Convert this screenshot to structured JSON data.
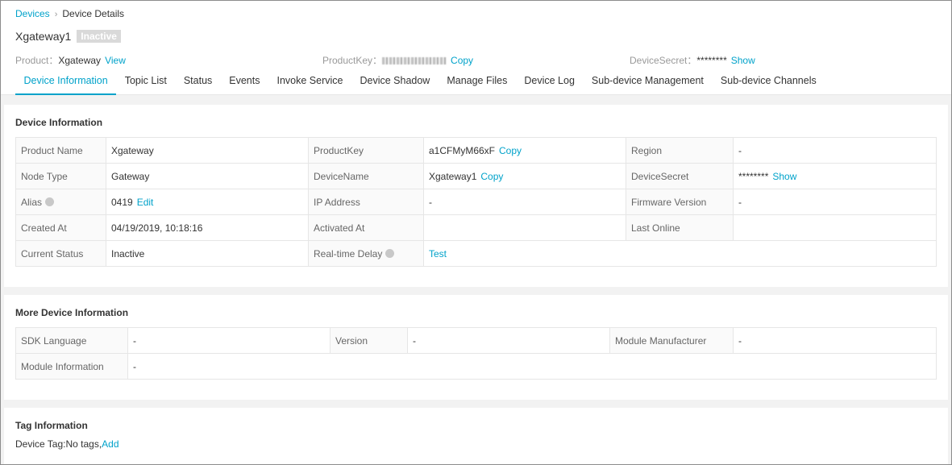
{
  "breadcrumb": {
    "root": "Devices",
    "separator": "›",
    "current": "Device Details"
  },
  "device": {
    "name": "Xgateway1",
    "status_badge": "Inactive"
  },
  "header_meta": {
    "product_label": "Product：",
    "product_value": "Xgateway",
    "product_link": "View",
    "productkey_label": "ProductKey：",
    "productkey_link": "Copy",
    "devicesecret_label": "DeviceSecret：",
    "devicesecret_value": "********",
    "devicesecret_link": "Show"
  },
  "tabs": [
    {
      "label": "Device Information",
      "active": true
    },
    {
      "label": "Topic List"
    },
    {
      "label": "Status"
    },
    {
      "label": "Events"
    },
    {
      "label": "Invoke Service"
    },
    {
      "label": "Device Shadow"
    },
    {
      "label": "Manage Files"
    },
    {
      "label": "Device Log"
    },
    {
      "label": "Sub-device Management"
    },
    {
      "label": "Sub-device Channels"
    }
  ],
  "device_info": {
    "title": "Device Information",
    "product_name_label": "Product Name",
    "product_name": "Xgateway",
    "productkey_label": "ProductKey",
    "productkey": "a1CFMyM66xF",
    "productkey_link": "Copy",
    "region_label": "Region",
    "region": "-",
    "node_type_label": "Node Type",
    "node_type": "Gateway",
    "devicename_label": "DeviceName",
    "devicename": "Xgateway1",
    "devicename_link": "Copy",
    "devicesecret_label": "DeviceSecret",
    "devicesecret": "********",
    "devicesecret_link": "Show",
    "alias_label": "Alias",
    "alias": "0419",
    "alias_link": "Edit",
    "ip_label": "IP Address",
    "ip": "-",
    "firmware_label": "Firmware Version",
    "firmware": "-",
    "created_label": "Created At",
    "created": "04/19/2019, 10:18:16",
    "activated_label": "Activated At",
    "activated": "",
    "last_online_label": "Last Online",
    "last_online": "",
    "current_status_label": "Current Status",
    "current_status": "Inactive",
    "delay_label": "Real-time Delay",
    "delay_link": "Test"
  },
  "more_info": {
    "title": "More Device Information",
    "sdk_label": "SDK Language",
    "sdk": "-",
    "version_label": "Version",
    "version": "-",
    "manufacturer_label": "Module Manufacturer",
    "manufacturer": "-",
    "module_info_label": "Module Information",
    "module_info": "-"
  },
  "tag_info": {
    "title": "Tag Information",
    "prefix": "Device Tag:No tags,",
    "add_link": "Add"
  },
  "colors": {
    "accent": "#00a2ca",
    "badge_bg": "#d9d9d9",
    "page_bg": "#f2f2f2"
  }
}
